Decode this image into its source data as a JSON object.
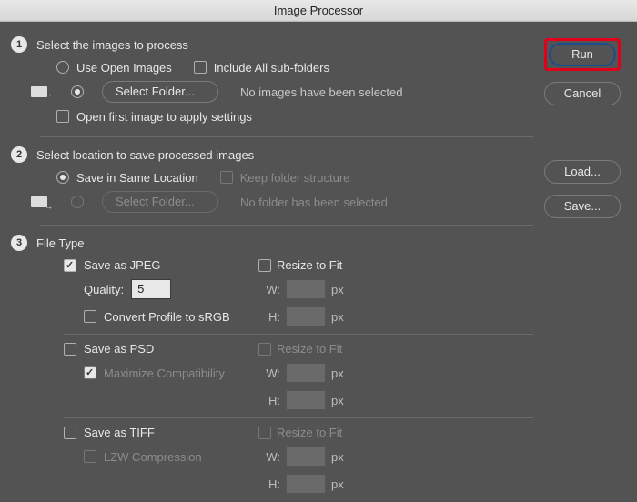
{
  "title": "Image Processor",
  "buttons": {
    "run": "Run",
    "cancel": "Cancel",
    "load": "Load...",
    "save": "Save..."
  },
  "sec1": {
    "num": "1",
    "title": "Select the images to process",
    "use_open": "Use Open Images",
    "include_sub": "Include All sub-folders",
    "select_folder": "Select Folder...",
    "no_images": "No images have been selected",
    "open_first": "Open first image to apply settings"
  },
  "sec2": {
    "num": "2",
    "title": "Select location to save processed images",
    "save_same": "Save in Same Location",
    "keep_structure": "Keep folder structure",
    "select_folder": "Select Folder...",
    "no_folder": "No folder has been selected"
  },
  "sec3": {
    "num": "3",
    "title": "File Type",
    "jpeg": {
      "label": "Save as JPEG",
      "quality_label": "Quality:",
      "quality_value": "5",
      "convert": "Convert Profile to sRGB",
      "resize": "Resize to Fit",
      "w": "W:",
      "h": "H:",
      "px": "px"
    },
    "psd": {
      "label": "Save as PSD",
      "maximize": "Maximize Compatibility",
      "resize": "Resize to Fit",
      "w": "W:",
      "h": "H:",
      "px": "px"
    },
    "tiff": {
      "label": "Save as TIFF",
      "lzw": "LZW Compression",
      "resize": "Resize to Fit",
      "w": "W:",
      "h": "H:",
      "px": "px"
    }
  }
}
